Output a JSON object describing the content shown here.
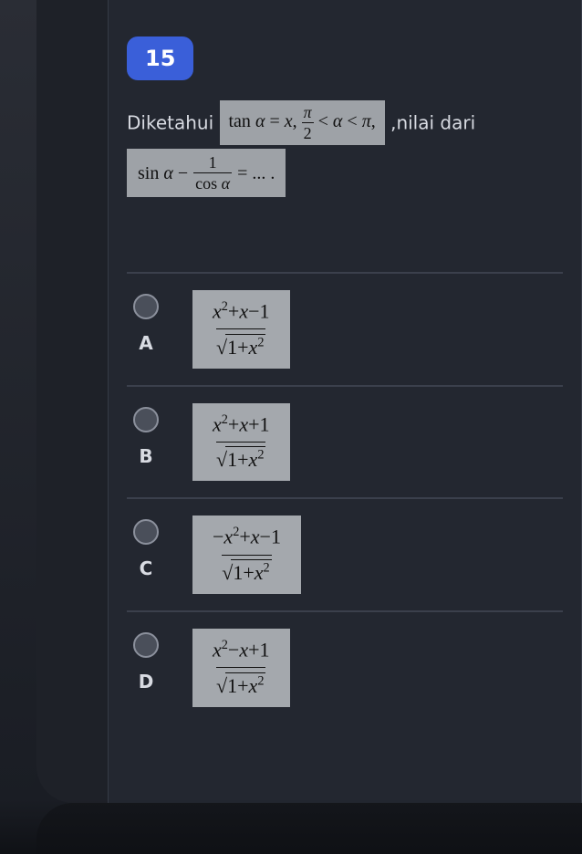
{
  "question": {
    "number": "15",
    "lead_in": "Diketahui",
    "eq1_html": "tan <i>α</i> = <i>x</i>,&nbsp;",
    "eq1_frac_num": "π",
    "eq1_frac_den": "2",
    "eq1_tail_html": "< <i>α</i> < <i>π</i>,",
    "mid_text": ",nilai  dari",
    "eq2_left_html": "sin <i>α</i>  −",
    "eq2_frac_num": "1",
    "eq2_frac_den_html": "cos <i>α</i>",
    "eq2_right": "= ... ."
  },
  "options": [
    {
      "letter": "A",
      "num_html": "<i>x</i><span class=\"sup\">2</span>+<i>x</i>−1",
      "den_inside_html": "1+<i>x</i><span class=\"sup\">2</span>"
    },
    {
      "letter": "B",
      "num_html": "<i>x</i><span class=\"sup\">2</span>+<i>x</i>+1",
      "den_inside_html": "1+<i>x</i><span class=\"sup\">2</span>"
    },
    {
      "letter": "C",
      "num_html": "−<i>x</i><span class=\"sup\">2</span>+<i>x</i>−1",
      "den_inside_html": "1+<i>x</i><span class=\"sup\">2</span>"
    },
    {
      "letter": "D",
      "num_html": "<i>x</i><span class=\"sup\">2</span>−<i>x</i>+1",
      "den_inside_html": "1+<i>x</i><span class=\"sup\">2</span>"
    }
  ]
}
